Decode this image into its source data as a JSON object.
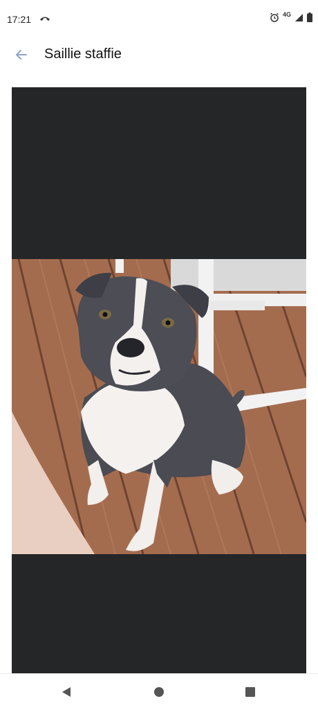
{
  "status_bar": {
    "time": "17:21",
    "network": "4G",
    "icons": [
      "missed-call-icon",
      "alarm-icon",
      "signal-icon",
      "battery-icon"
    ]
  },
  "app_bar": {
    "title": "Saillie staffie",
    "back_icon": "arrow-left-icon"
  },
  "viewer": {
    "background": "#252628",
    "image_subject": "grey and white staffie dog sitting on a wooden deck"
  },
  "nav_bar": {
    "icons": [
      "triangle-back-icon",
      "circle-home-icon",
      "square-recents-icon"
    ]
  }
}
